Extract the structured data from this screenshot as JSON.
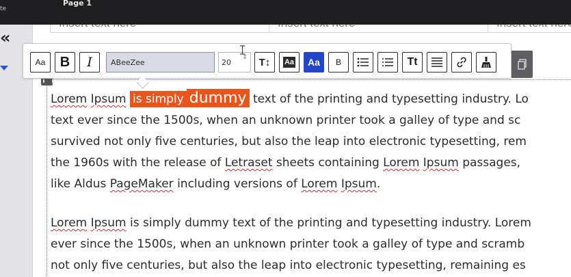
{
  "topbar": {
    "left_fragment": "te",
    "page_label": "Page 1"
  },
  "sidebar": {
    "collapse_icon": "«"
  },
  "table": {
    "cells": [
      "Insert text here",
      "Insert text here",
      "Insert text here"
    ]
  },
  "toolbar": {
    "font_family_value": "ABeeZee",
    "font_size_value": "20",
    "spin_glyph": "⇕",
    "bold_label": "B",
    "italic_label": "I",
    "size_label": "Aa",
    "text_height_label": "T↕",
    "bg_color_label": "Aa",
    "text_color_label": "Aa",
    "small_bold_label": "B",
    "title_case_label": "Tt",
    "active_color": "#2346c8"
  },
  "editor": {
    "paragraph1": {
      "word_lorem": "Lorem",
      "word_ipsum": "Ipsum",
      "highlight_small": "is simply",
      "highlight_big": "dummy",
      "line1_rest": "text of the printing and typesetting industry. Lo",
      "line2": "text ever since the 1500s, when an unknown printer took a galley of type and sc",
      "line3": "survived not only five centuries, but also the leap into electronic typesetting, rem",
      "line4_a": "the 1960s with the release of",
      "word_letraset": "Letraset",
      "line4_b": "sheets containing",
      "line4_c": "passages,",
      "line5_a": "like Aldus",
      "word_pagemaker": "PageMaker",
      "line5_b": "including versions of",
      "line5_end": "."
    },
    "paragraph2": {
      "line1_rest": "is simply dummy text of the printing and typesetting industry. Lorem",
      "line2": "ever since the 1500s, when an unknown printer took a galley of type and scramb",
      "line3": "not only five centuries, but also the leap into electronic typesetting, remaining es"
    },
    "highlight_color": "#e8561e"
  }
}
